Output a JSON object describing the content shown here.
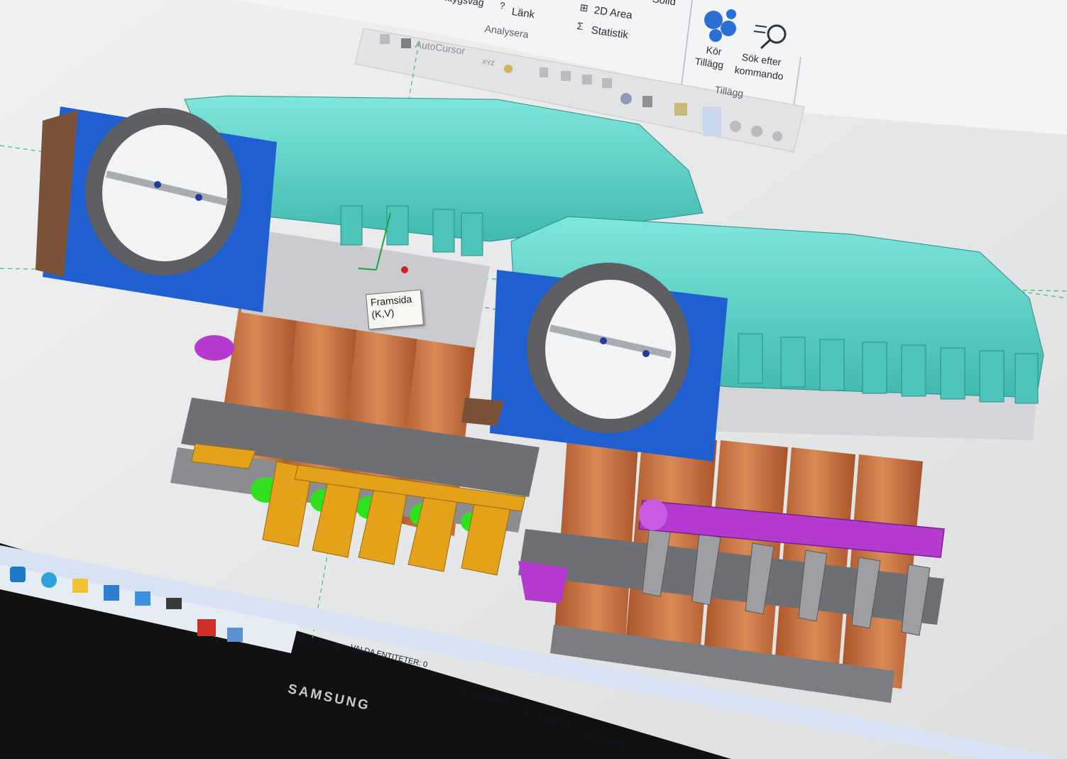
{
  "ribbon": {
    "verktygsvag": "ktygsväg",
    "lank": "Länk",
    "area2d": "2D Area",
    "statistik": "Statistik",
    "solid": "Solid",
    "analysera": "Analysera",
    "kor_line1": "Kör",
    "kor_line2": "Tillägg",
    "sok_line1": "Sök efter",
    "sok_line2": "kommando",
    "tillagg_group": "Tillägg",
    "lank_glyph": "?",
    "sigma_glyph": "Σ",
    "area_glyph": "⊞"
  },
  "toolbar": {
    "autocursor": "AutoCursor",
    "xyz": "XYZ"
  },
  "viewport": {
    "tooltip_line1": "Framsida",
    "tooltip_line2": "(K,V)"
  },
  "statusbar": {
    "snittvy": "SNITTVY: AV",
    "valda": "VALDA ENTITETER: 0",
    "x_label": "X:",
    "x_value": "442.92844",
    "y_label": "Y:",
    "y_value": "-21.48790",
    "z_label": "Z:",
    "z_value": "0.00000"
  },
  "monitor": {
    "brand": "SAMSUNG"
  },
  "colors": {
    "plenum": "#5fd3c8",
    "throttle_body": "#1f5fd0",
    "runners": "#c86a3a",
    "fuel_rail": "#b43ad0",
    "coil_packs": "#e3a21a",
    "green_parts": "#2ee01e",
    "flange": "#6d6f73"
  }
}
